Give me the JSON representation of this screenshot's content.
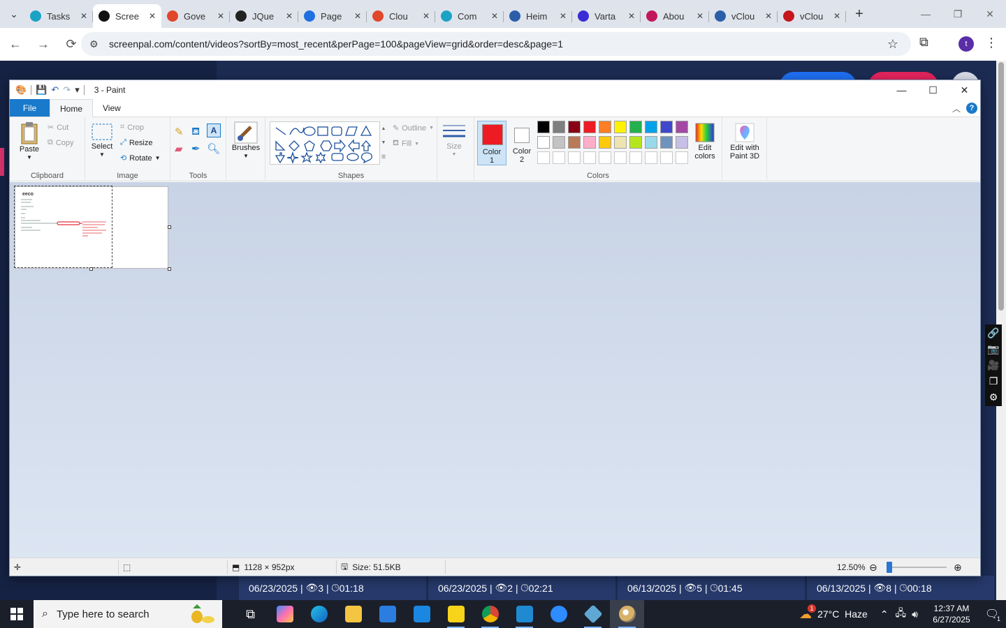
{
  "browser": {
    "tabs": [
      {
        "label": "Tasks",
        "color": "#1aa3c4"
      },
      {
        "label": "Scree",
        "color": "#111111"
      },
      {
        "label": "Gove",
        "color": "#e0472b"
      },
      {
        "label": "JQue",
        "color": "#222222"
      },
      {
        "label": "Page",
        "color": "#1f6fe0"
      },
      {
        "label": "Clou",
        "color": "#e0472b"
      },
      {
        "label": "Com",
        "color": "#1aa3c4"
      },
      {
        "label": "Heim",
        "color": "#2b5ea8"
      },
      {
        "label": "Varta",
        "color": "#3a2bd6"
      },
      {
        "label": "Abou",
        "color": "#c2185b"
      },
      {
        "label": "vClou",
        "color": "#2b5ea8"
      },
      {
        "label": "vClou",
        "color": "#c4161c"
      }
    ],
    "url": "screenpal.com/content/videos?sortBy=most_recent&perPage=100&pageView=grid&order=desc&page=1",
    "profile_initial": "t"
  },
  "webpage": {
    "videos": [
      {
        "date": "06/23/2025",
        "views": "3",
        "duration": "01:18"
      },
      {
        "date": "06/23/2025",
        "views": "2",
        "duration": "02:21"
      },
      {
        "date": "06/13/2025",
        "views": "5",
        "duration": "01:45"
      },
      {
        "date": "06/13/2025",
        "views": "8",
        "duration": "00:18"
      }
    ]
  },
  "paint": {
    "title": "3 - Paint",
    "ribbon_tabs": {
      "file": "File",
      "home": "Home",
      "view": "View"
    },
    "clipboard": {
      "paste": "Paste",
      "cut": "Cut",
      "copy": "Copy",
      "label": "Clipboard"
    },
    "image": {
      "select": "Select",
      "crop": "Crop",
      "resize": "Resize",
      "rotate": "Rotate",
      "label": "Image"
    },
    "tools": {
      "label": "Tools"
    },
    "brushes": {
      "label": "Brushes"
    },
    "shapes": {
      "outline": "Outline",
      "fill": "Fill",
      "label": "Shapes"
    },
    "size": {
      "label": "Size"
    },
    "colors": {
      "color1_label": "Color 1",
      "color2_label": "Color 2",
      "color1": "#ed1c24",
      "color2": "#ffffff",
      "edit_colors": "Edit colors",
      "edit_paint3d": "Edit with Paint 3D",
      "label": "Colors",
      "palette_row1": [
        "#000000",
        "#7f7f7f",
        "#880015",
        "#ed1c24",
        "#ff7f27",
        "#fff200",
        "#22b14c",
        "#00a2e8",
        "#3f48cc",
        "#a349a4"
      ],
      "palette_row2": [
        "#ffffff",
        "#c3c3c3",
        "#b97a57",
        "#ffaec9",
        "#ffc90e",
        "#efe4b0",
        "#b5e61d",
        "#99d9ea",
        "#7092be",
        "#c8bfe7"
      ]
    },
    "status": {
      "dimensions": "1128 × 952px",
      "size": "Size: 51.5KB",
      "zoom": "12.50%"
    }
  },
  "taskbar": {
    "search_placeholder": "Type here to search",
    "weather": "27°C  Haze",
    "weather_badge": "1",
    "time": "12:37 AM",
    "date": "6/27/2025",
    "notification_count": "1"
  }
}
